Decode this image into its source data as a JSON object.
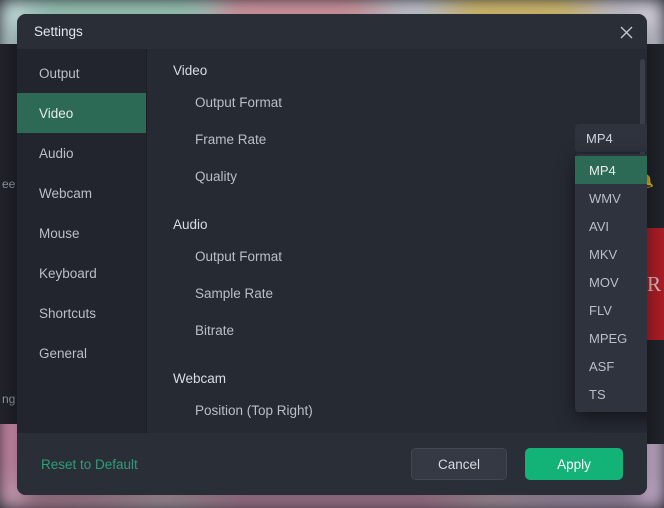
{
  "background": {
    "bell_icon": "bell-icon",
    "left_text_fragment": "ee",
    "left_text_fragment_2": "ng",
    "red_letter": "R"
  },
  "dialog": {
    "title": "Settings",
    "close_icon": "close-icon"
  },
  "sidebar": {
    "items": [
      {
        "label": "Output",
        "active": false
      },
      {
        "label": "Video",
        "active": true
      },
      {
        "label": "Audio",
        "active": false
      },
      {
        "label": "Webcam",
        "active": false
      },
      {
        "label": "Mouse",
        "active": false
      },
      {
        "label": "Keyboard",
        "active": false
      },
      {
        "label": "Shortcuts",
        "active": false
      },
      {
        "label": "General",
        "active": false
      }
    ]
  },
  "content": {
    "video": {
      "title": "Video",
      "rows": [
        {
          "label": "Output Format"
        },
        {
          "label": "Frame Rate"
        },
        {
          "label": "Quality"
        }
      ]
    },
    "audio": {
      "title": "Audio",
      "rows": [
        {
          "label": "Output Format"
        },
        {
          "label": "Sample Rate"
        },
        {
          "label": "Bitrate"
        }
      ]
    },
    "webcam": {
      "title": "Webcam",
      "rows": [
        {
          "label": "Position (Top Right)"
        }
      ],
      "position_tiles": [
        {
          "name": "top-left",
          "selected": false
        },
        {
          "name": "top-right",
          "selected": true
        },
        {
          "name": "bottom-left",
          "selected": false
        },
        {
          "name": "bottom-right",
          "selected": false
        }
      ]
    }
  },
  "dropdown": {
    "name": "video-output-format-dropdown",
    "selected_value": "MP4",
    "caret_icon": "chevron-down-icon",
    "open": true,
    "options": [
      {
        "label": "MP4",
        "selected": true
      },
      {
        "label": "WMV",
        "selected": false
      },
      {
        "label": "AVI",
        "selected": false
      },
      {
        "label": "MKV",
        "selected": false
      },
      {
        "label": "MOV",
        "selected": false
      },
      {
        "label": "FLV",
        "selected": false
      },
      {
        "label": "MPEG",
        "selected": false
      },
      {
        "label": "ASF",
        "selected": false
      },
      {
        "label": "TS",
        "selected": false
      }
    ]
  },
  "footer": {
    "reset_label": "Reset to Default",
    "cancel_label": "Cancel",
    "apply_label": "Apply"
  },
  "colors": {
    "accent_green": "#13b277",
    "selection_green": "#2c6a55",
    "link_green": "#2f9e78",
    "dialog_bg": "#242830",
    "content_bg": "#262a33",
    "sidebar_bg": "#22252d",
    "titlebar_bg": "#2a2e37"
  }
}
